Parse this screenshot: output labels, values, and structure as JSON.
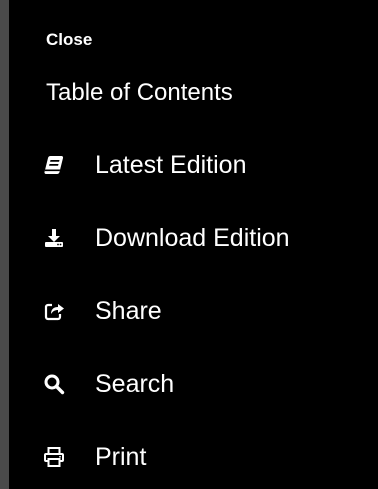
{
  "menu": {
    "close_label": "Close",
    "toc_label": "Table of Contents",
    "items": [
      {
        "label": "Latest Edition",
        "icon": "book-icon"
      },
      {
        "label": "Download Edition",
        "icon": "download-icon"
      },
      {
        "label": "Share",
        "icon": "share-icon"
      },
      {
        "label": "Search",
        "icon": "search-icon"
      },
      {
        "label": "Print",
        "icon": "print-icon"
      }
    ]
  },
  "colors": {
    "background": "#000000",
    "text": "#ffffff",
    "edge_bar": "#4a4a4a"
  }
}
